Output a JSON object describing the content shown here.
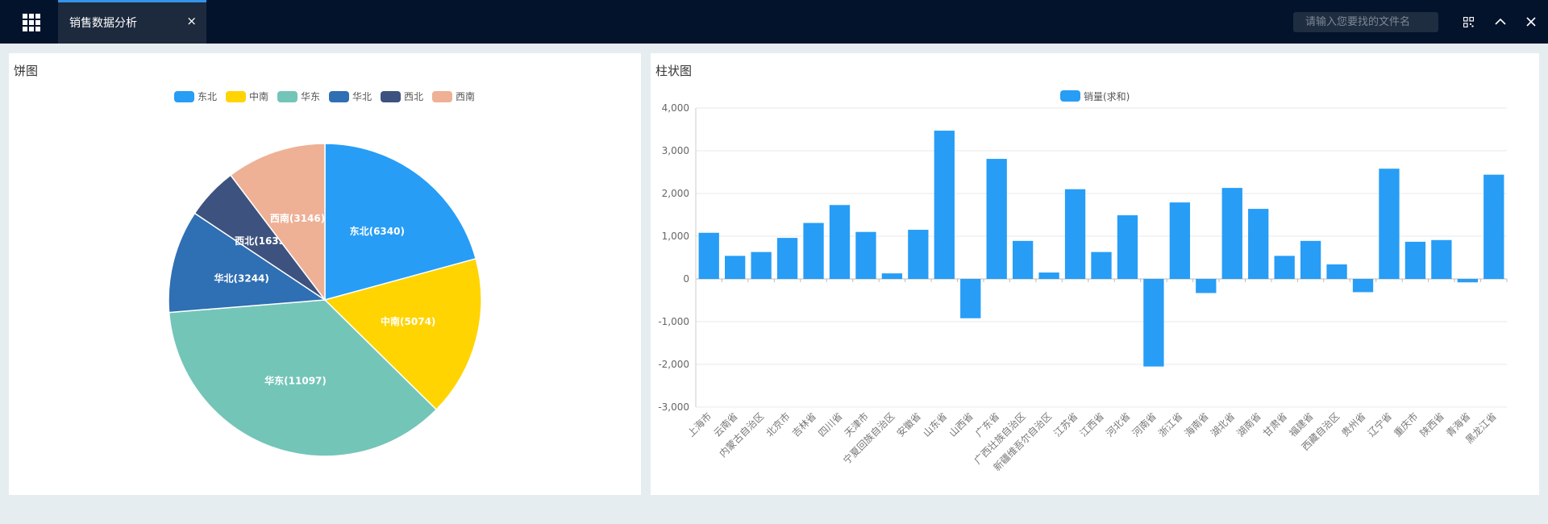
{
  "header": {
    "tab_title": "销售数据分析",
    "close_glyph": "×",
    "search_placeholder": "请输入您要找的文件名",
    "icons": [
      "apps-grid-icon",
      "search-icon",
      "qrcode-icon",
      "chevron-up-icon",
      "close-icon"
    ]
  },
  "pie_panel": {
    "title": "饼图",
    "chart_data": {
      "type": "pie",
      "legend": [
        "东北",
        "中南",
        "华东",
        "华北",
        "西北",
        "西南"
      ],
      "legend_placement": "top-center",
      "slices": [
        {
          "name": "东北",
          "value": 6340,
          "label": "东北(6340)",
          "color": "#279df6"
        },
        {
          "name": "中南",
          "value": 5074,
          "label": "中南(5074)",
          "color": "#ffd400"
        },
        {
          "name": "华东",
          "value": 11097,
          "label": "华东(11097)",
          "color": "#73c5b7"
        },
        {
          "name": "华北",
          "value": 3244,
          "label": "华北(3244)",
          "color": "#2f6fb3"
        },
        {
          "name": "西北",
          "value": 1635,
          "label": "西北(1635)",
          "color": "#3d527e"
        },
        {
          "name": "西南",
          "value": 3146,
          "label": "西南(3146)",
          "color": "#eeb196"
        }
      ]
    }
  },
  "bar_panel": {
    "title": "柱状图",
    "chart_data": {
      "type": "bar",
      "series": [
        {
          "name": "销量(求和)",
          "color": "#279df6"
        }
      ],
      "legend_placement": "top-center",
      "ylim": [
        -3000,
        4000
      ],
      "y_ticks": [
        4000,
        3000,
        2000,
        1000,
        0,
        -1000,
        -2000,
        -3000
      ],
      "y_tick_labels": [
        "4,000",
        "3,000",
        "2,000",
        "1,000",
        "0",
        "-1,000",
        "-2,000",
        "-3,000"
      ],
      "grid": true,
      "categories": [
        "上海市",
        "云南省",
        "内蒙古自治区",
        "北京市",
        "吉林省",
        "四川省",
        "天津市",
        "宁夏回族自治区",
        "安徽省",
        "山东省",
        "山西省",
        "广东省",
        "广西壮族自治区",
        "新疆维吾尔自治区",
        "江苏省",
        "江西省",
        "河北省",
        "河南省",
        "浙江省",
        "海南省",
        "湖北省",
        "湖南省",
        "甘肃省",
        "福建省",
        "西藏自治区",
        "贵州省",
        "辽宁省",
        "重庆市",
        "陕西省",
        "青海省",
        "黑龙江省"
      ],
      "values": [
        1080,
        540,
        630,
        960,
        1310,
        1730,
        1100,
        130,
        1150,
        3470,
        -920,
        2810,
        890,
        150,
        2100,
        630,
        1490,
        -2050,
        1790,
        -330,
        2130,
        1640,
        540,
        890,
        340,
        -310,
        2580,
        870,
        910,
        -80,
        2440
      ]
    }
  }
}
